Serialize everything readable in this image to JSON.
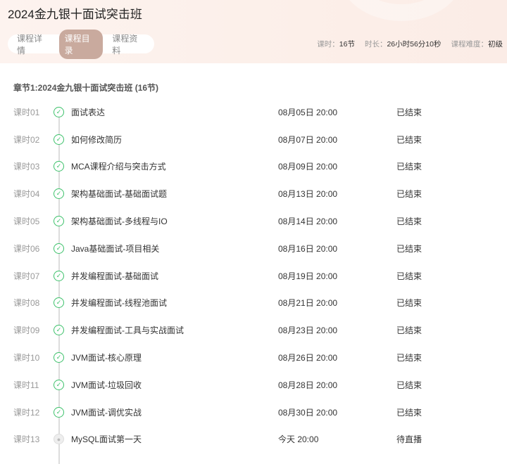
{
  "title": "2024金九银十面试突击班",
  "tabs": [
    "课程详情",
    "课程目录",
    "课程资料"
  ],
  "meta": {
    "lessons_label": "课时：",
    "lessons": "16节",
    "duration_label": "时长：",
    "duration": "26小时56分10秒",
    "level_label": "课程难度：",
    "level": "初级"
  },
  "chapter": "章节1:2024金九银十面试突击班 (16节)",
  "lessons": [
    {
      "num": "课时01",
      "name": "面试表达",
      "time": "08月05日 20:00",
      "status": "已结束",
      "icon": "check-circle-icon"
    },
    {
      "num": "课时02",
      "name": "如何修改简历",
      "time": "08月07日 20:00",
      "status": "已结束",
      "icon": "check-circle-icon"
    },
    {
      "num": "课时03",
      "name": "MCA课程介绍与突击方式",
      "time": "08月09日 20:00",
      "status": "已结束",
      "icon": "check-circle-icon"
    },
    {
      "num": "课时04",
      "name": "架构基础面试-基础面试题",
      "time": "08月13日 20:00",
      "status": "已结束",
      "icon": "check-circle-icon"
    },
    {
      "num": "课时05",
      "name": "架构基础面试-多线程与IO",
      "time": "08月14日 20:00",
      "status": "已结束",
      "icon": "check-circle-icon"
    },
    {
      "num": "课时06",
      "name": "Java基础面试-项目相关",
      "time": "08月16日 20:00",
      "status": "已结束",
      "icon": "check-circle-icon"
    },
    {
      "num": "课时07",
      "name": "并发编程面试-基础面试",
      "time": "08月19日 20:00",
      "status": "已结束",
      "icon": "check-circle-icon"
    },
    {
      "num": "课时08",
      "name": "并发编程面试-线程池面试",
      "time": "08月21日 20:00",
      "status": "已结束",
      "icon": "check-circle-icon"
    },
    {
      "num": "课时09",
      "name": "并发编程面试-工具与实战面试",
      "time": "08月23日 20:00",
      "status": "已结束",
      "icon": "check-circle-icon"
    },
    {
      "num": "课时10",
      "name": "JVM面试-核心原理",
      "time": "08月26日 20:00",
      "status": "已结束",
      "icon": "check-circle-icon"
    },
    {
      "num": "课时11",
      "name": "JVM面试-垃圾回收",
      "time": "08月28日 20:00",
      "status": "已结束",
      "icon": "check-circle-icon"
    },
    {
      "num": "课时12",
      "name": "JVM面试-调优实战",
      "time": "08月30日 20:00",
      "status": "已结束",
      "icon": "check-circle-icon"
    },
    {
      "num": "课时13",
      "name": "MySQL面试第一天",
      "time": "今天 20:00",
      "status": "待直播",
      "icon": "lock-icon"
    }
  ]
}
